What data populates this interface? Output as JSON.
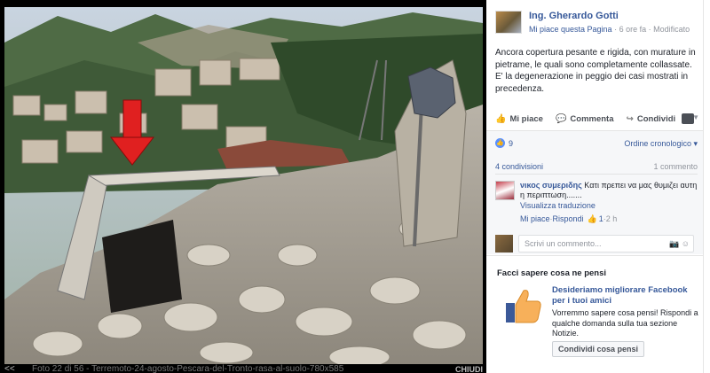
{
  "photo": {
    "caption": "Foto 22 di 56 - Terremoto-24-agosto-Pescara-del-Tronto-rasa-al-suolo-780x585",
    "prev_label": "<<",
    "close_label": "CHIUDI"
  },
  "post": {
    "author": "Ing. Gherardo Gotti",
    "like_page": "Mi piace questa Pagina",
    "time": "6 ore fa",
    "edited": "Modificato",
    "text": "Ancora copertura pesante e rigida, con murature in pietrame, le quali sono completamente collassate. E' la degenerazione in peggio dei casi mostrati in precedenza.",
    "actions": {
      "like": "Mi piace",
      "comment": "Commenta",
      "share": "Condividi"
    }
  },
  "stats": {
    "likes": "9",
    "order": "Ordine cronologico",
    "shares": "4 condivisioni",
    "comments": "1 commento"
  },
  "comment": {
    "author": "νικος συμεριδης",
    "text": "Κατι πρεπει να μας θυμιζει αυτη η περιπτωση.......",
    "translate": "Visualizza traduzione",
    "like": "Mi piace",
    "reply": "Rispondi",
    "likes": "1",
    "time": "2 h"
  },
  "composer": {
    "placeholder": "Scrivi un commento..."
  },
  "feedback": {
    "title": "Facci sapere cosa ne pensi",
    "heading": "Desideriamo migliorare Facebook per i tuoi amici",
    "body": "Vorremmo sapere cosa pensi! Rispondi a qualche domanda sulla tua sezione Notizie.",
    "button": "Condividi cosa pensi"
  },
  "colors": {
    "link": "#365899",
    "muted": "#90949c",
    "like_badge": "#5890ff",
    "arrow": "#e02020"
  }
}
